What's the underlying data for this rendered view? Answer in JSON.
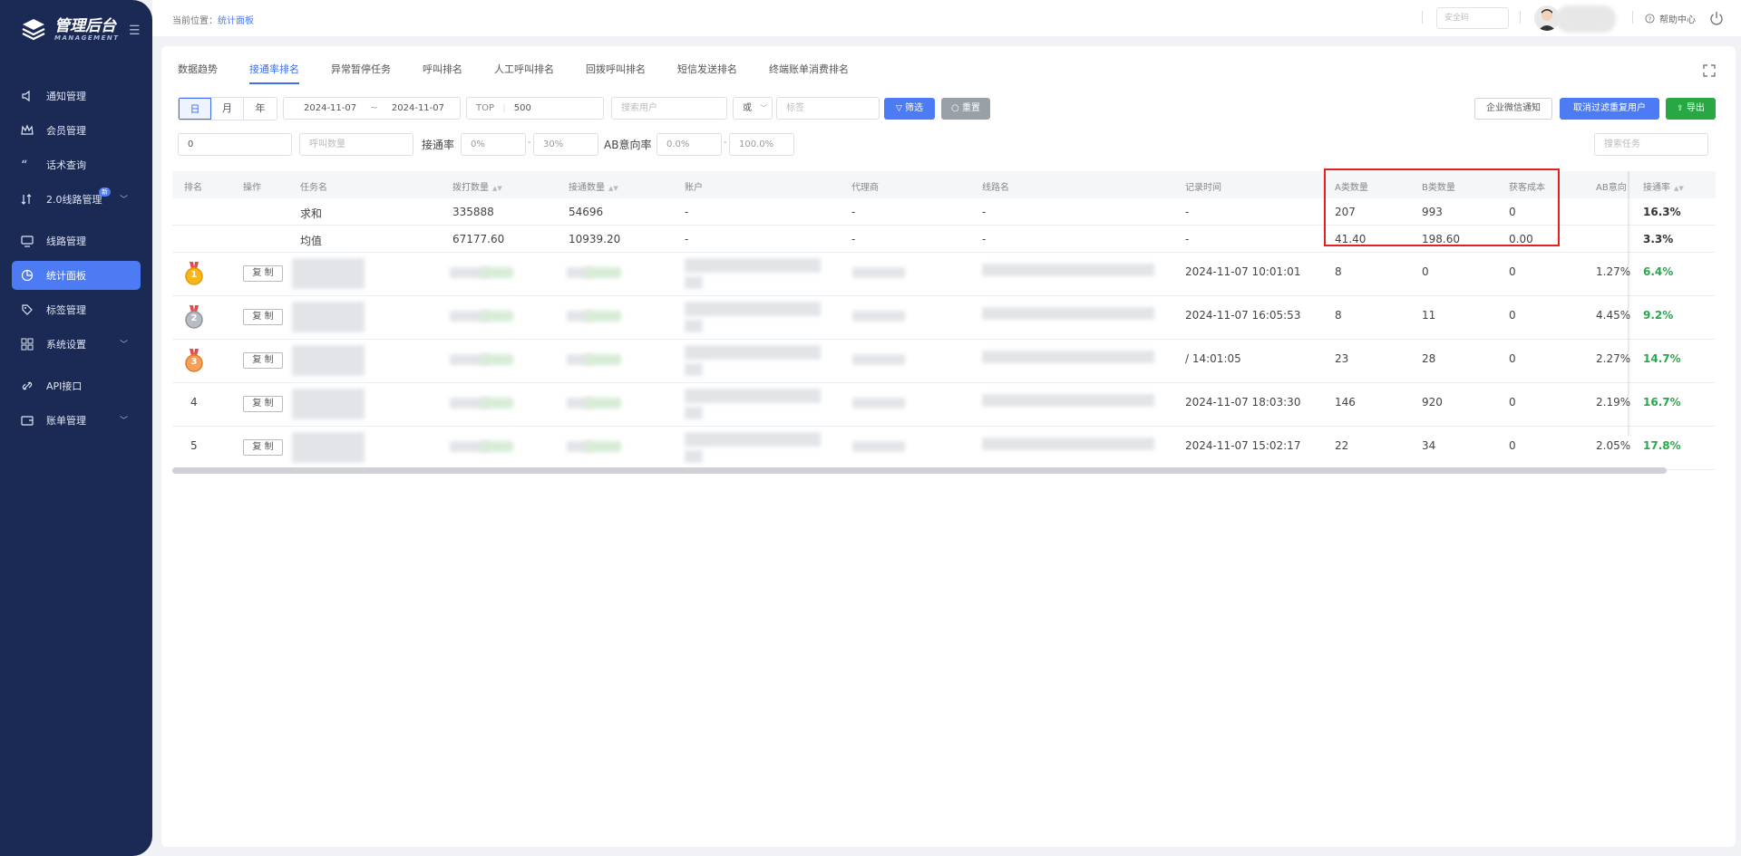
{
  "sidebar": {
    "logo_title": "管理后台",
    "logo_subtitle": "MANAGEMENT",
    "items": [
      {
        "label": "通知管理",
        "icon": "volume-icon"
      },
      {
        "label": "会员管理",
        "icon": "crown-icon"
      },
      {
        "label": "话术查询",
        "icon": "quote-icon"
      },
      {
        "label": "2.0线路管理",
        "icon": "sort-icon",
        "badge": "新"
      },
      {
        "label": "线路管理",
        "icon": "monitor-icon"
      },
      {
        "label": "统计面板",
        "icon": "pie-icon",
        "active": true
      },
      {
        "label": "标签管理",
        "icon": "tag-icon"
      },
      {
        "label": "系统设置",
        "icon": "grid-icon"
      },
      {
        "label": "API接口",
        "icon": "api-icon"
      },
      {
        "label": "账单管理",
        "icon": "bill-icon"
      }
    ]
  },
  "header": {
    "breadcrumb_prefix": "当前位置：",
    "breadcrumb_current": "统计面板",
    "safe_code_placeholder": "安全码",
    "help_label": "帮助中心"
  },
  "tabs": [
    "数据趋势",
    "接通率排名",
    "异常暂停任务",
    "呼叫排名",
    "人工呼叫排名",
    "回拨呼叫排名",
    "短信发送排名",
    "终端账单消费排名"
  ],
  "filters": {
    "period": [
      "日",
      "月",
      "年"
    ],
    "date_start": "2024-11-07",
    "date_sep": "~",
    "date_end": "2024-11-07",
    "top_label": "TOP",
    "top_value": "500",
    "search_user_placeholder": "搜索用户",
    "logic_value": "或",
    "tag_placeholder": "标签",
    "filter_btn": "筛选",
    "reset_btn": "重置",
    "wechat_btn": "企业微信通知",
    "cancel_filter_btn": "取消过滤重复用户",
    "export_btn": "导出",
    "min_calls_value": "0",
    "call_count_placeholder": "呼叫数量",
    "rate_label": "接通率",
    "rate_from": "0%",
    "rate_to": "30%",
    "ab_label": "AB意向率",
    "ab_from": "0.0%",
    "ab_to": "100.0%",
    "search_task_placeholder": "搜索任务"
  },
  "table": {
    "headers": {
      "rank": "排名",
      "op": "操作",
      "task": "任务名",
      "dial": "拨打数量",
      "connect": "接通数量",
      "account": "账户",
      "agent": "代理商",
      "line": "线路名",
      "time": "记录时间",
      "a": "A类数量",
      "b": "B类数量",
      "cost": "获客成本",
      "ab": "AB意向",
      "rate": "接通率"
    },
    "sum": {
      "task": "求和",
      "dial": "335888",
      "connect": "54696",
      "account": "-",
      "agent": "-",
      "line": "-",
      "time": "-",
      "a": "207",
      "b": "993",
      "cost": "0",
      "rate": "16.3%"
    },
    "avg": {
      "task": "均值",
      "dial": "67177.60",
      "connect": "10939.20",
      "account": "-",
      "agent": "-",
      "line": "-",
      "time": "-",
      "a": "41.40",
      "b": "198.60",
      "cost": "0.00",
      "rate": "3.3%"
    },
    "copy_label": "复 制",
    "rows": [
      {
        "rank": "1",
        "time": "2024-11-07 10:01:01",
        "a": "8",
        "b": "0",
        "cost": "0",
        "ab": "1.27%",
        "rate": "6.4%"
      },
      {
        "rank": "2",
        "time": "2024-11-07 16:05:53",
        "a": "8",
        "b": "11",
        "cost": "0",
        "ab": "4.45%",
        "rate": "9.2%"
      },
      {
        "rank": "3",
        "time": "/ 14:01:05",
        "a": "23",
        "b": "28",
        "cost": "0",
        "ab": "2.27%",
        "rate": "14.7%"
      },
      {
        "rank": "4",
        "time": "2024-11-07 18:03:30",
        "a": "146",
        "b": "920",
        "cost": "0",
        "ab": "2.19%",
        "rate": "16.7%"
      },
      {
        "rank": "5",
        "time": "2024-11-07 15:02:17",
        "a": "22",
        "b": "34",
        "cost": "0",
        "ab": "2.05%",
        "rate": "17.8%"
      }
    ]
  },
  "colors": {
    "accent": "#4c7bf3",
    "sidebar": "#1b2a55",
    "highlight_box": "#e51f1f",
    "rate_green": "#29a84a"
  }
}
